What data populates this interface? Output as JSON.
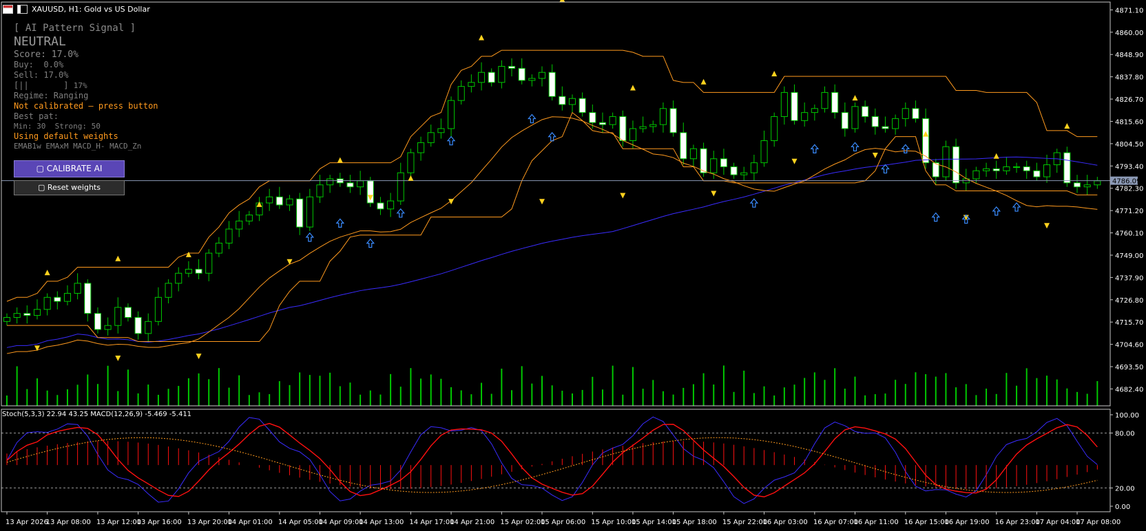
{
  "window": {
    "title": "XAUUSD, H1:  Gold vs US Dollar",
    "menu_icon": "table-icon",
    "chart_icon": "chart-icon"
  },
  "colors": {
    "bull": "#00c800",
    "bear_fill": "#ffffff",
    "orange": "#ff9a1e",
    "blue_ma": "#3a2cff",
    "stoch_main": "#3a2cff",
    "stoch_signal": "#ff1010",
    "macd_hist": "#ff1010",
    "macd_signal": "#ff9a1e",
    "volume": "#00c800",
    "arrow_up": "#3a8cff",
    "fractal": "#ffd21e",
    "price_line": "#8c9ab6"
  },
  "panel": {
    "header": "[ AI Pattern Signal ]",
    "signal": "NEUTRAL",
    "score": "Score: 17.0%",
    "buy": "Buy:  0.0%",
    "sell": "Sell: 17.0%",
    "bar": "[||       ]",
    "bar_pct": "17%",
    "regime": "Regime: Ranging",
    "calib_status": "Not calibrated — press button",
    "best_pat": "Best pat:",
    "min_strong": "Min: 30  Strong: 50",
    "weights": "Using default weights",
    "features": "EMAB1w EMAxM MACD_H- MACD_Zn",
    "calibrate_btn": "▢ CALIBRATE AI",
    "reset_btn": "▢ Reset weights"
  },
  "indicator_label": "Stoch(5,3,3) 22.94 43.25 MACD(12,26,9) -5.469 -5.411",
  "chart_data": {
    "type": "candlestick",
    "symbol": "XAUUSD",
    "timeframe": "H1",
    "current_price": "4786.09",
    "ylim": [
      4674.0,
      4875.0
    ],
    "price_ticks": [
      "4871.10",
      "4860.00",
      "4848.90",
      "4837.80",
      "4826.70",
      "4815.60",
      "4804.50",
      "4793.40",
      "4782.30",
      "4771.20",
      "4760.10",
      "4749.00",
      "4737.90",
      "4726.80",
      "4715.70",
      "4704.60",
      "4693.50",
      "4682.40"
    ],
    "price_tick_values": [
      4871.1,
      4860.0,
      4848.9,
      4837.8,
      4826.7,
      4815.6,
      4804.5,
      4793.4,
      4782.3,
      4771.2,
      4760.1,
      4749.0,
      4737.9,
      4726.8,
      4715.7,
      4704.6,
      4693.5,
      4682.4
    ],
    "osc_ticks": [
      "100.00",
      "80.00",
      "20.00",
      "0.00"
    ],
    "osc_tick_values": [
      100,
      80,
      20,
      0
    ],
    "time_labels": [
      "13 Apr 2026",
      "13 Apr 08:00",
      "13 Apr 12:00",
      "13 Apr 16:00",
      "13 Apr 20:00",
      "14 Apr 01:00",
      "14 Apr 05:00",
      "14 Apr 09:00",
      "14 Apr 13:00",
      "14 Apr 17:00",
      "14 Apr 21:00",
      "15 Apr 02:00",
      "15 Apr 06:00",
      "15 Apr 10:00",
      "15 Apr 14:00",
      "15 Apr 18:00",
      "15 Apr 22:00",
      "16 Apr 03:00",
      "16 Apr 07:00",
      "16 Apr 11:00",
      "16 Apr 15:00",
      "16 Apr 19:00",
      "16 Apr 23:00",
      "17 Apr 04:00",
      "17 Apr 08:00"
    ],
    "closes": [
      4718,
      4720,
      4719,
      4722,
      4728,
      4726,
      4730,
      4735,
      4720,
      4712,
      4714,
      4723,
      4718,
      4710,
      4716,
      4728,
      4735,
      4740,
      4742,
      4740,
      4750,
      4755,
      4762,
      4766,
      4769,
      4775,
      4778,
      4774,
      4777,
      4763,
      4778,
      4784,
      4787,
      4785,
      4783,
      4786,
      4775,
      4772,
      4776,
      4790,
      4800,
      4805,
      4810,
      4812,
      4826,
      4833,
      4835,
      4840,
      4835,
      4843,
      4842,
      4836,
      4837,
      4840,
      4828,
      4824,
      4827,
      4820,
      4815,
      4814,
      4818,
      4806,
      4812,
      4813,
      4814,
      4822,
      4810,
      4797,
      4802,
      4790,
      4797,
      4793,
      4789,
      4790,
      4795,
      4806,
      4818,
      4830,
      4816,
      4820,
      4822,
      4830,
      4820,
      4812,
      4823,
      4818,
      4813,
      4812,
      4817,
      4822,
      4817,
      4795,
      4788,
      4803,
      4785,
      4787,
      4791,
      4792,
      4791,
      4793,
      4793,
      4791,
      4788,
      4794,
      4800,
      4785,
      4783,
      4784,
      4786
    ],
    "fractals_up": [
      4739,
      4746,
      4748,
      4773,
      4795,
      4786,
      4856,
      4875,
      4831,
      4834,
      4838,
      4826,
      4808,
      4797,
      4812
    ],
    "fractals_down": [
      4704,
      4699,
      4700,
      4747,
      4779,
      4777,
      4777,
      4780,
      4781,
      4797,
      4800,
      4769,
      4765
    ],
    "volume_max_rel": 1.0
  }
}
